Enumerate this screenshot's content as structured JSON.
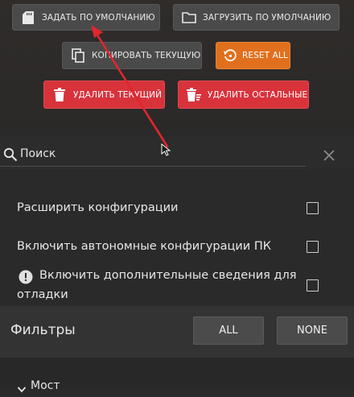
{
  "buttons": {
    "set_default": "ЗАДАТЬ ПО УМОЛЧАНИЮ",
    "load_default": "ЗАГРУЗИТЬ ПО УМОЛЧАНИЮ",
    "copy_current": "КОПИРОВАТЬ ТЕКУЩУЮ",
    "reset_all": "RESET ALL",
    "delete_current": "УДАЛИТЬ ТЕКУЩИЙ",
    "delete_others": "УДАЛИТЬ ОСТАЛЬНЫЕ"
  },
  "search": {
    "label": "Поиск"
  },
  "options": [
    {
      "label": "Расширить конфигурации",
      "checked": false
    },
    {
      "label": "Включить автономные конфигурации ПК",
      "checked": false
    },
    {
      "label_line1": "Включить дополнительные сведения для",
      "label_line2": "отладки",
      "checked": false
    }
  ],
  "filters": {
    "title": "Фильтры",
    "all_label": "ALL",
    "none_label": "NONE"
  },
  "section": {
    "label": "Мост"
  },
  "colors": {
    "accent_orange": "#e0701d",
    "danger_red": "#d8323b",
    "annotation_arrow": "#e0262e"
  },
  "icons": [
    "sd-card-icon",
    "folder-icon",
    "copy-icon",
    "reset-icon",
    "trash-icon",
    "trash-lines-icon",
    "search-icon",
    "close-icon",
    "info-icon",
    "chevron-down-icon",
    "cursor-icon"
  ]
}
